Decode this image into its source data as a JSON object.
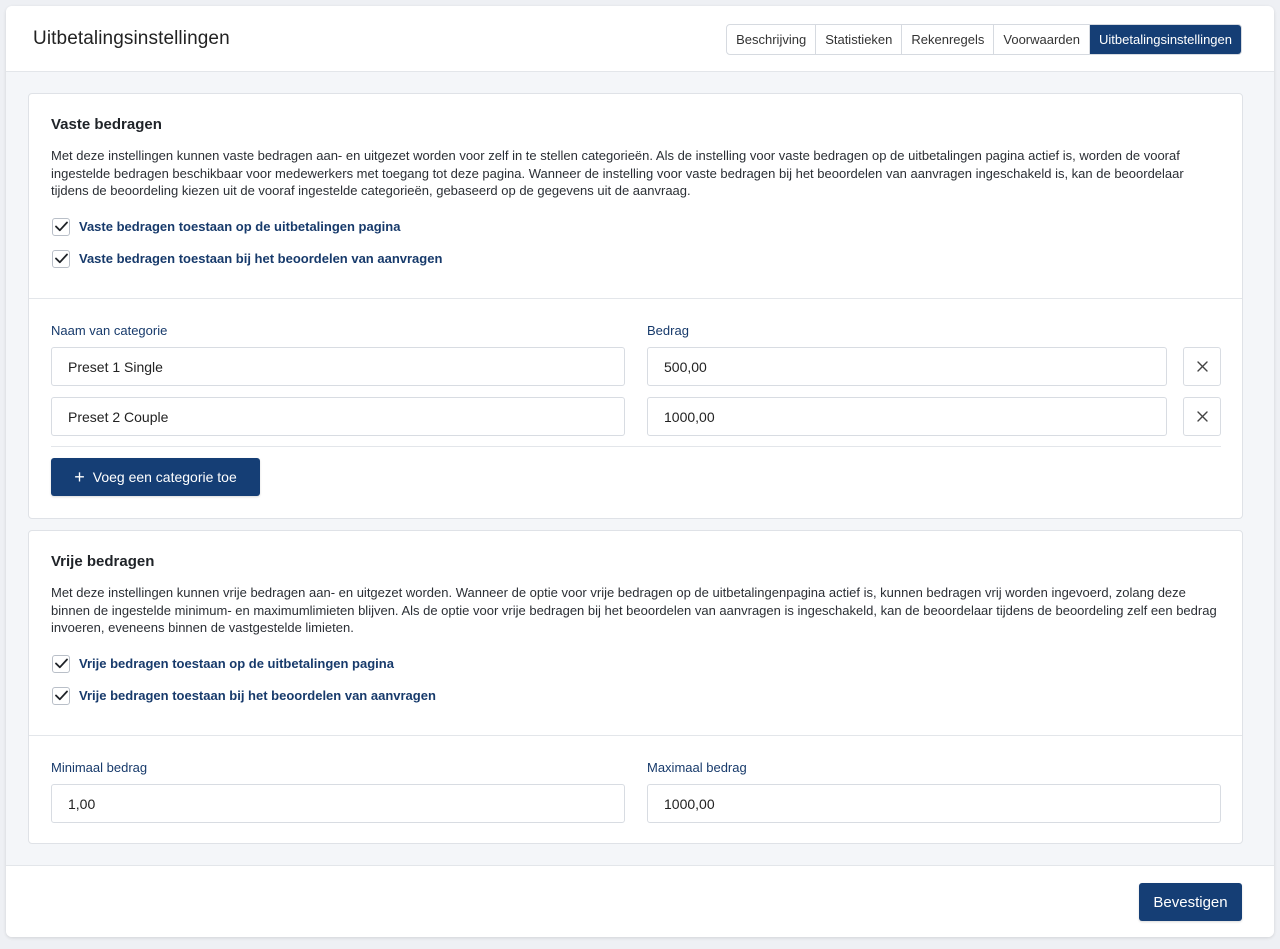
{
  "header": {
    "title": "Uitbetalingsinstellingen",
    "tabs": [
      {
        "label": "Beschrijving"
      },
      {
        "label": "Statistieken"
      },
      {
        "label": "Rekenregels"
      },
      {
        "label": "Voorwaarden"
      },
      {
        "label": "Uitbetalingsinstellingen"
      }
    ],
    "active_tab": "Uitbetalingsinstellingen"
  },
  "fixed": {
    "title": "Vaste bedragen",
    "description": "Met deze instellingen kunnen vaste bedragen aan- en uitgezet worden voor zelf in te stellen categorieën. Als de instelling voor vaste bedragen op de uitbetalingen pagina actief is, worden de vooraf ingestelde bedragen beschikbaar voor medewerkers met toegang tot deze pagina. Wanneer de instelling voor vaste bedragen bij het beoordelen van aanvragen ingeschakeld is, kan de beoordelaar tijdens de beoordeling kiezen uit de vooraf ingestelde categorieën, gebaseerd op de gegevens uit de aanvraag.",
    "checkboxes": [
      {
        "label": "Vaste bedragen toestaan op de uitbetalingen pagina",
        "checked": true
      },
      {
        "label": "Vaste bedragen toestaan bij het beoordelen van aanvragen",
        "checked": true
      }
    ],
    "name_label": "Naam van categorie",
    "amount_label": "Bedrag",
    "rows": [
      {
        "name": "Preset 1 Single",
        "amount": "500,00"
      },
      {
        "name": "Preset 2 Couple",
        "amount": "1000,00"
      }
    ],
    "add_button": "Voeg een categorie toe"
  },
  "free": {
    "title": "Vrije bedragen",
    "description": "Met deze instellingen kunnen vrije bedragen aan- en uitgezet worden. Wanneer de optie voor vrije bedragen op de uitbetalingenpagina actief is, kunnen bedragen vrij worden ingevoerd, zolang deze binnen de ingestelde minimum- en maximumlimieten blijven. Als de optie voor vrije bedragen bij het beoordelen van aanvragen is ingeschakeld, kan de beoordelaar tijdens de beoordeling zelf een bedrag invoeren, eveneens binnen de vastgestelde limieten.",
    "checkboxes": [
      {
        "label": "Vrije bedragen toestaan op de uitbetalingen pagina",
        "checked": true
      },
      {
        "label": "Vrije bedragen toestaan bij het beoordelen van aanvragen",
        "checked": true
      }
    ],
    "min_label": "Minimaal bedrag",
    "min_value": "1,00",
    "max_label": "Maximaal bedrag",
    "max_value": "1000,00"
  },
  "footer": {
    "confirm_button": "Bevestigen"
  },
  "colors": {
    "primary": "#153e75",
    "label_text": "#173a6b"
  }
}
